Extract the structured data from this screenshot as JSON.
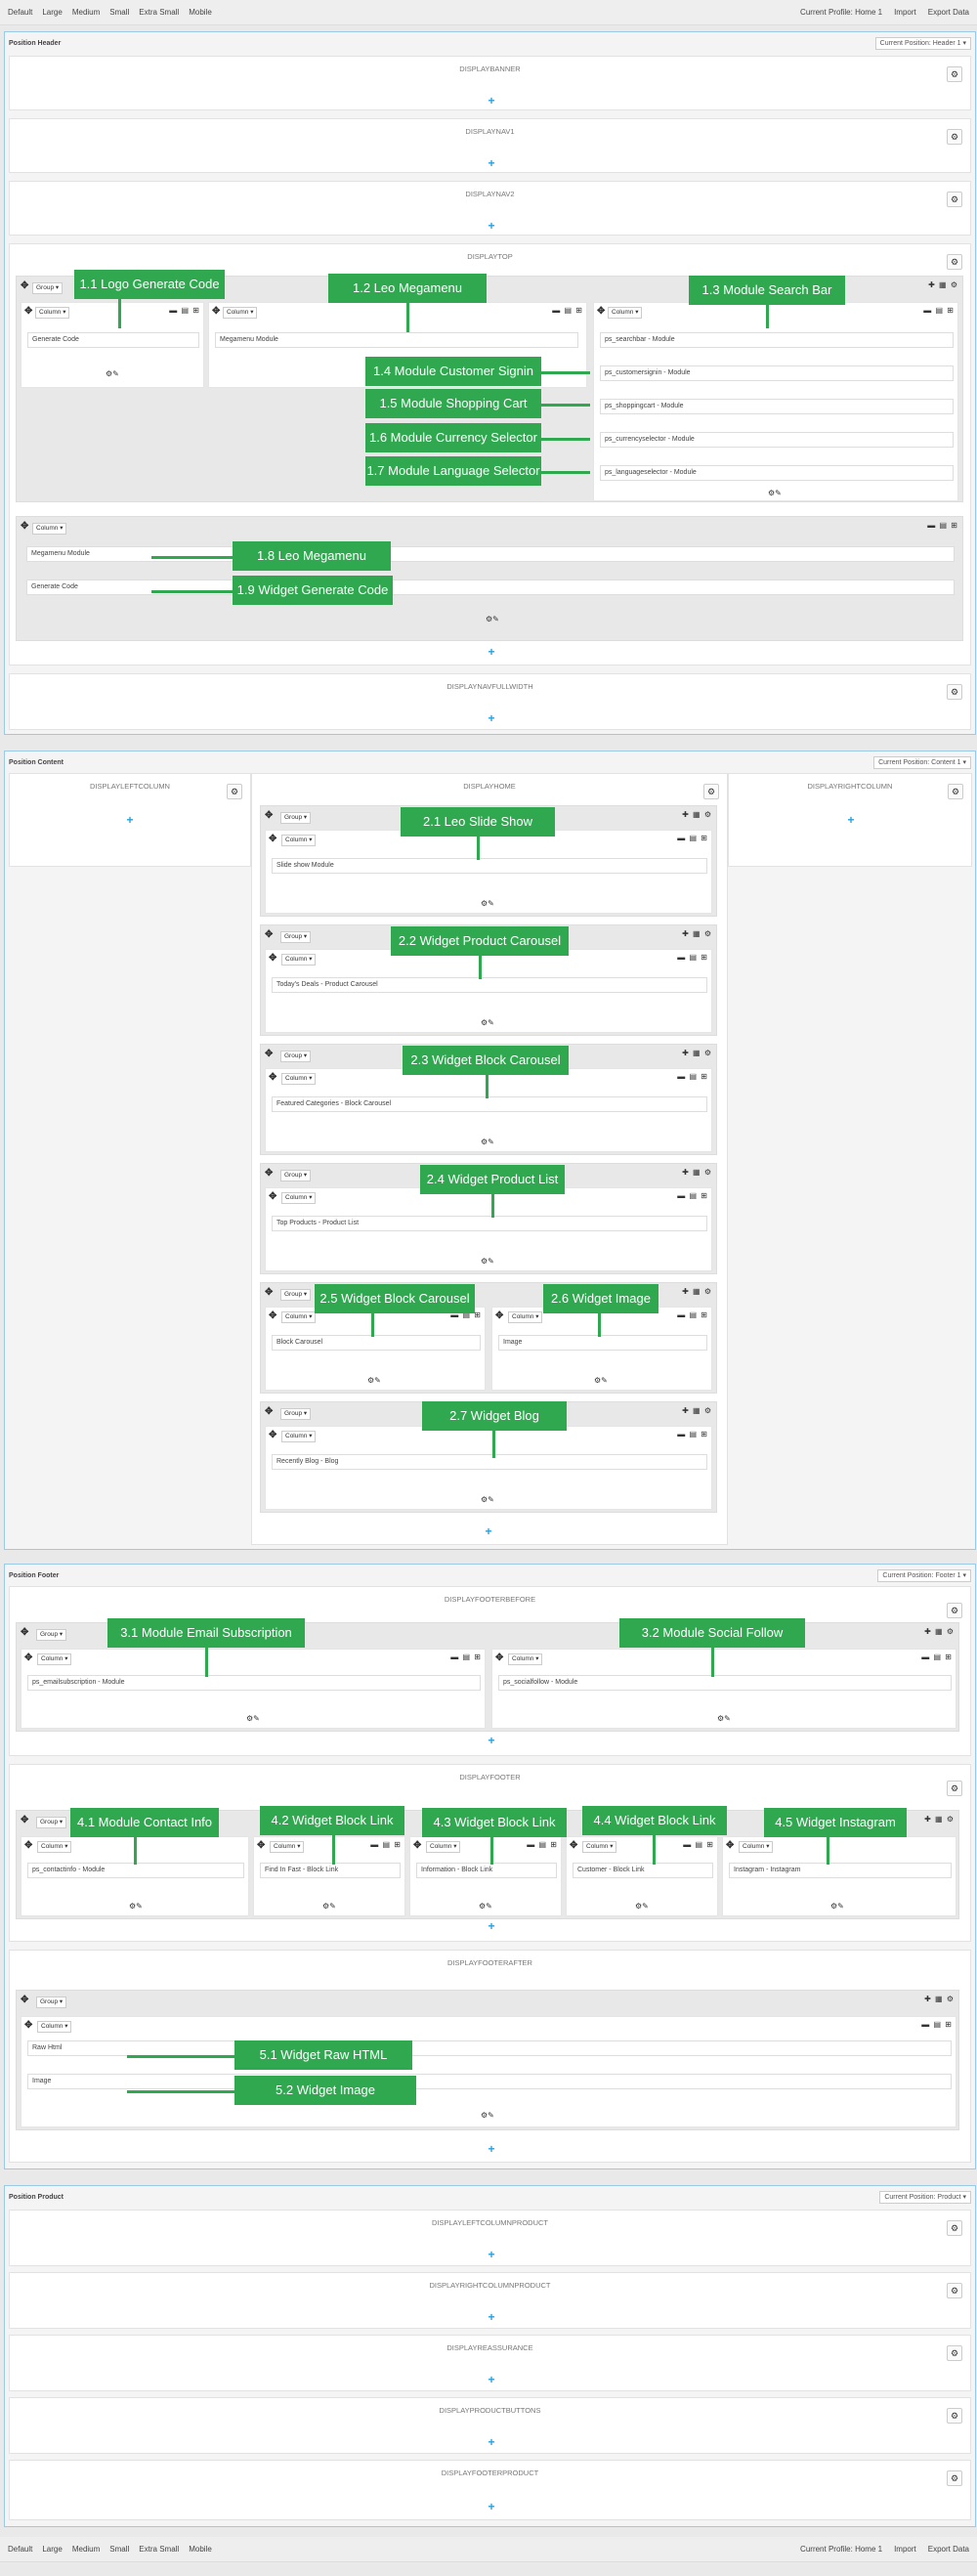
{
  "toolbar": {
    "devices": [
      "Default",
      "Large",
      "Medium",
      "Small",
      "Extra Small",
      "Mobile"
    ],
    "profile": "Current Profile: Home 1",
    "import": "Import",
    "export": "Export Data"
  },
  "header": {
    "title": "Position Header",
    "position_btn": "Current Position: Header 1 ▾",
    "hooks": [
      "DISPLAYBANNER",
      "DISPLAYNAV1",
      "DISPLAYNAV2",
      "DISPLAYTOP",
      "DISPLAYNAVFULLWIDTH"
    ],
    "modules": {
      "gen1": "Generate Code",
      "mega1": "Megamenu Module",
      "search": "ps_searchbar - Module",
      "signin": "ps_customersignin - Module",
      "cart": "ps_shoppingcart - Module",
      "currency": "ps_currencyselector - Module",
      "lang": "ps_languageselector - Module",
      "mega2": "Megamenu Module",
      "gen2": "Generate Code"
    },
    "annotations": [
      "1.1 Logo Generate Code",
      "1.2 Leo Megamenu",
      "1.3 Module Search Bar",
      "1.4 Module Customer Signin",
      "1.5 Module Shopping Cart",
      "1.6 Module Currency Selector",
      "1.7 Module Language Selector",
      "1.8 Leo Megamenu",
      "1.9 Widget Generate Code"
    ]
  },
  "content": {
    "title": "Position Content",
    "position_btn": "Current Position: Content 1 ▾",
    "hooks": [
      "DISPLAYLEFTCOLUMN",
      "DISPLAYHOME",
      "DISPLAYRIGHTCOLUMN"
    ],
    "modules": [
      "Slide show Module",
      "Today's Deals - Product Carousel",
      "Featured Categories - Block Carousel",
      "Top Products - Product List",
      "Block Carousel",
      "Image",
      "Recently Blog - Blog"
    ],
    "annotations": [
      "2.1 Leo Slide Show",
      "2.2 Widget Product Carousel",
      "2.3 Widget Block Carousel",
      "2.4 Widget Product List",
      "2.5 Widget Block Carousel",
      "2.6 Widget Image",
      "2.7 Widget Blog"
    ]
  },
  "footer": {
    "title": "Position Footer",
    "position_btn": "Current Position: Footer 1 ▾",
    "hooks": [
      "DISPLAYFOOTERBEFORE",
      "DISPLAYFOOTER",
      "DISPLAYFOOTERAFTER"
    ],
    "modules": [
      "ps_emailsubscription - Module",
      "ps_socialfollow - Module",
      "ps_contactinfo - Module",
      "Find In Fast - Block Link",
      "Information - Block Link",
      "Customer - Block Link",
      "Instagram - Instagram",
      "Raw Html",
      "Image"
    ],
    "annotations": [
      "3.1 Module Email Subscription",
      "3.2 Module Social Follow",
      "4.1 Module Contact Info",
      "4.2 Widget Block Link",
      "4.3 Widget Block Link",
      "4.4 Widget Block Link",
      "4.5 Widget Instagram",
      "5.1 Widget Raw HTML",
      "5.2 Widget Image"
    ]
  },
  "product": {
    "title": "Position Product",
    "position_btn": "Current Position: Product ▾",
    "hooks": [
      "DISPLAYLEFTCOLUMNPRODUCT",
      "DISPLAYRIGHTCOLUMNPRODUCT",
      "DISPLAYREASSURANCE",
      "DISPLAYPRODUCTBUTTONS",
      "DISPLAYFOOTERPRODUCT"
    ]
  },
  "labels": {
    "group": "Group ▾",
    "column": "Column ▾"
  }
}
